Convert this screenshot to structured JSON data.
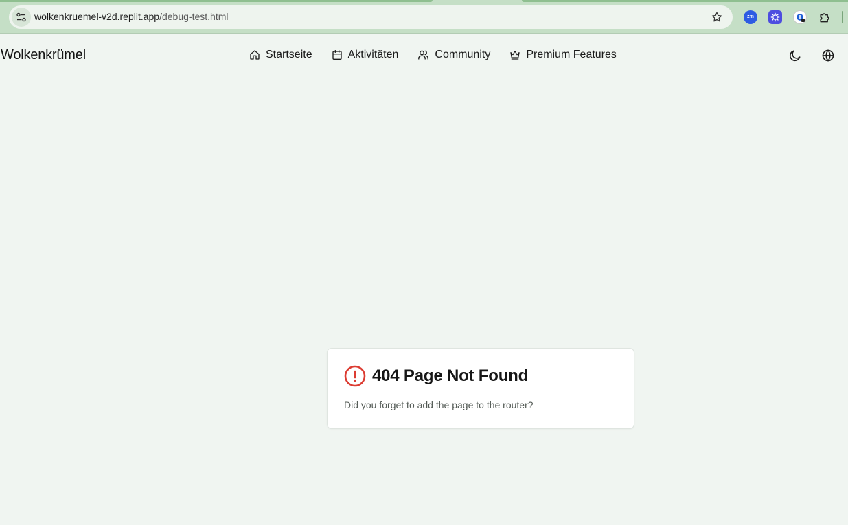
{
  "browser": {
    "url_host": "wolkenkruemel-v2d.replit.app",
    "url_path": "/debug-test.html",
    "extensions": [
      {
        "name": "zoom-extension-icon",
        "label": "zm"
      },
      {
        "name": "gear-extension-icon"
      },
      {
        "name": "password-extension-icon"
      },
      {
        "name": "puzzle-extensions-icon"
      }
    ]
  },
  "header": {
    "brand": "Wolkenkrümel",
    "nav": [
      {
        "label": "Startseite",
        "icon": "home-icon"
      },
      {
        "label": "Aktivitäten",
        "icon": "calendar-icon"
      },
      {
        "label": "Community",
        "icon": "users-icon"
      },
      {
        "label": "Premium Features",
        "icon": "crown-icon"
      }
    ],
    "theme_icon": "moon-icon",
    "language_icon": "globe-icon"
  },
  "error_card": {
    "title": "404 Page Not Found",
    "message": "Did you forget to add the page to the router?",
    "icon": "alert-circle-icon",
    "icon_color": "#dc3c32"
  },
  "colors": {
    "page_background": "#f0f5f1",
    "browser_bar": "#c5dfc6",
    "card_background": "#ffffff"
  }
}
